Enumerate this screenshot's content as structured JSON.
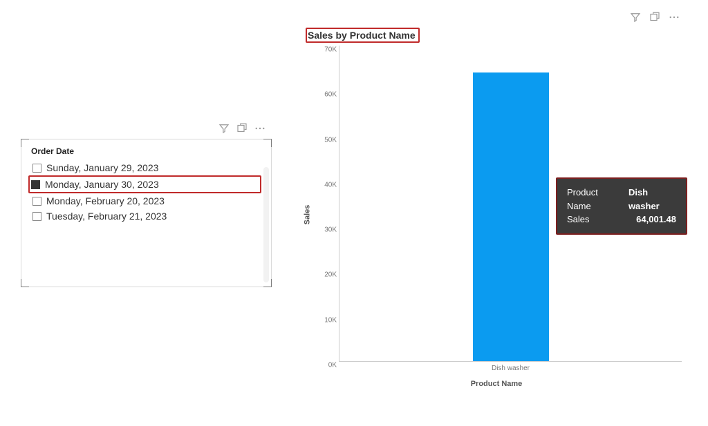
{
  "slicer": {
    "title": "Order Date",
    "items": [
      {
        "label": "Sunday, January 29, 2023",
        "checked": false
      },
      {
        "label": "Monday, January 30, 2023",
        "checked": true
      },
      {
        "label": "Monday, February 20, 2023",
        "checked": false
      },
      {
        "label": "Tuesday, February 21, 2023",
        "checked": false
      }
    ]
  },
  "chart": {
    "title": "Sales by Product Name",
    "xlabel": "Product Name",
    "ylabel": "Sales",
    "category_label": "Dish washer"
  },
  "tooltip": {
    "k1": "Product Name",
    "v1": "Dish washer",
    "k2": "Sales",
    "v2": "64,001.48"
  },
  "chart_data": {
    "type": "bar",
    "title": "Sales by Product Name",
    "xlabel": "Product Name",
    "ylabel": "Sales",
    "categories": [
      "Dish washer"
    ],
    "values": [
      64001.48
    ],
    "ylim": [
      0,
      70000
    ],
    "yticks": [
      0,
      10000,
      20000,
      30000,
      40000,
      50000,
      60000,
      70000
    ],
    "ytick_labels": [
      "0K",
      "10K",
      "20K",
      "30K",
      "40K",
      "50K",
      "60K",
      "70K"
    ]
  }
}
